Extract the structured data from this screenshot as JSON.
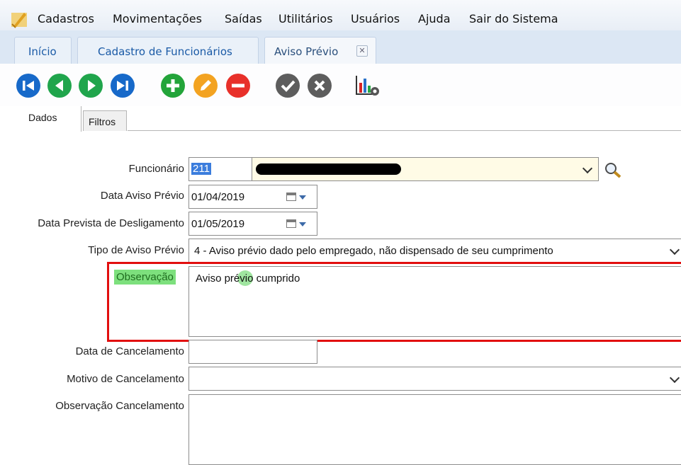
{
  "menu": [
    "Cadastros",
    "Movimentações",
    "Saídas",
    "Utilitários",
    "Usuários",
    "Ajuda",
    "Sair do Sistema"
  ],
  "tabs": [
    {
      "label": "Início"
    },
    {
      "label": "Cadastro de Funcionários"
    },
    {
      "label": "Aviso Prévio",
      "active": true,
      "close_icon": "close-icon"
    }
  ],
  "toolbar_icons": [
    "first-record-icon",
    "previous-record-icon",
    "next-record-icon",
    "last-record-icon",
    "add-icon",
    "edit-icon",
    "delete-icon",
    "confirm-icon",
    "cancel-icon",
    "report-settings-icon"
  ],
  "form_tabs": [
    "Dados",
    "Filtros"
  ],
  "form": {
    "funcionario_label": "Funcionário",
    "funcionario_code": "211",
    "data_aviso_label": "Data Aviso Prévio",
    "data_aviso_value": "01/04/2019",
    "data_prevista_label": "Data Prevista de Desligamento",
    "data_prevista_value": "01/05/2019",
    "tipo_label": "Tipo de Aviso Prévio",
    "tipo_value": "4 - Aviso prévio dado pelo empregado, não dispensado de seu cumprimento",
    "observacao_label": "Observação",
    "observacao_value": "Aviso prévio cumprido",
    "data_cancel_label": "Data de Cancelamento",
    "data_cancel_value": "",
    "motivo_cancel_label": "Motivo de Cancelamento",
    "motivo_cancel_value": "",
    "obs_cancel_label": "Observação Cancelamento",
    "obs_cancel_value": ""
  },
  "colors": {
    "highlight_red": "#e20f0f",
    "label_highlight": "#7de07d",
    "menu_bg": "#eef3f9",
    "tab_bg": "#dce7f4"
  }
}
